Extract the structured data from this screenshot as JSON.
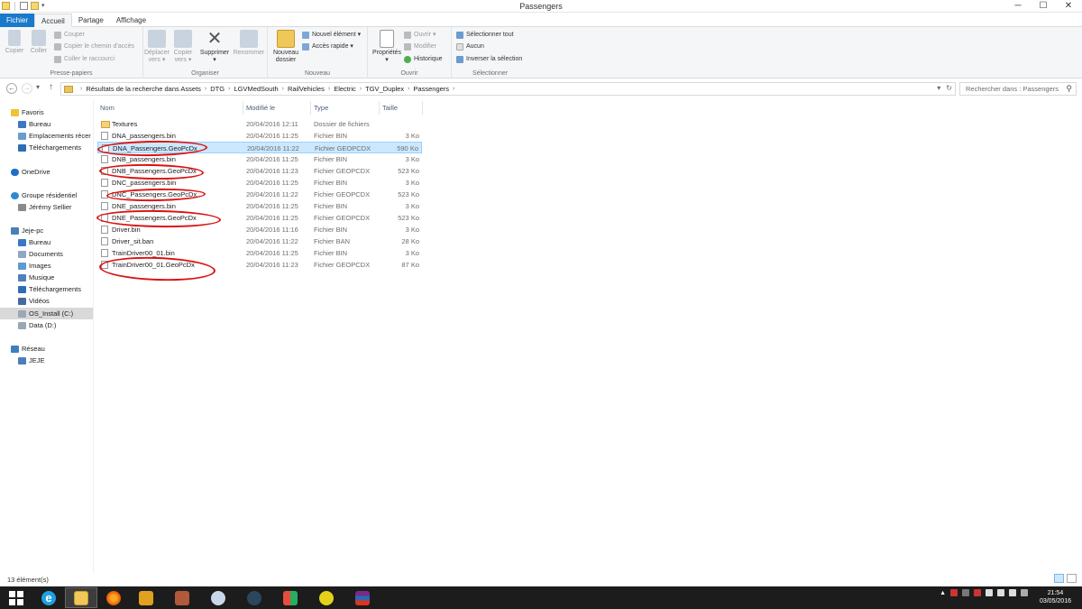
{
  "window": {
    "title": "Passengers",
    "controls": [
      "─",
      "☐",
      "✕"
    ]
  },
  "ribbon_tabs": [
    "Fichier",
    "Accueil",
    "Partage",
    "Affichage"
  ],
  "ribbon": {
    "presse_papiers": {
      "label": "Presse-papiers",
      "copier": "Copier",
      "coller": "Coller",
      "couper": "Couper",
      "copier_chemin": "Copier le chemin d'accès",
      "coller_raccourci": "Coller le raccourci"
    },
    "organiser": {
      "label": "Organiser",
      "deplacer_line1": "Déplacer",
      "deplacer_line2": "vers ▾",
      "copier_line1": "Copier",
      "copier_line2": "vers ▾",
      "supprimer_line1": "Supprimer",
      "supprimer_line2": "▾",
      "renommer": "Renommer"
    },
    "nouveau": {
      "label": "Nouveau",
      "dossier_line1": "Nouveau",
      "dossier_line2": "dossier",
      "nouvel_element": "Nouvel élément ▾",
      "acces_rapide": "Accès rapide ▾"
    },
    "ouvrir": {
      "label": "Ouvrir",
      "proprietes": "Propriétés",
      "proprietes_arrow": "▾",
      "ouvrir": "Ouvrir ▾",
      "modifier": "Modifier",
      "historique": "Historique"
    },
    "selectionner": {
      "label": "Sélectionner",
      "tout": "Sélectionner tout",
      "aucun": "Aucun",
      "inverser": "Inverser la sélection"
    }
  },
  "navigation": {
    "back": "←",
    "forward": "→",
    "recent": "▾",
    "up": "↑",
    "breadcrumb": [
      "Résultats de la recherche dans Assets",
      "DTG",
      "LGVMedSouth",
      "RailVehicles",
      "Electric",
      "TGV_Duplex",
      "Passengers"
    ],
    "address_dropdown": "▾",
    "refresh": "↻",
    "search_placeholder": "Rechercher dans : Passengers",
    "search_icon": "⚲"
  },
  "sidebar": [
    {
      "label": "Favoris",
      "icon": "star-icon",
      "color": "#f1c232"
    },
    {
      "label": "Bureau",
      "icon": "desktop-icon",
      "color": "#3b78c4"
    },
    {
      "label": "Emplacements récer",
      "icon": "recent-places-icon",
      "color": "#6a9bd1"
    },
    {
      "label": "Téléchargements",
      "icon": "downloads-icon",
      "color": "#2f6db5"
    },
    {
      "label": "OneDrive",
      "icon": "onedrive-icon",
      "color": "#1f6fc5"
    },
    {
      "label": "Groupe résidentiel",
      "icon": "homegroup-icon",
      "color": "#2c8ad1"
    },
    {
      "label": "Jérémy Sellier",
      "icon": "user-icon",
      "color": "#8a8a8a"
    },
    {
      "label": "Jeje-pc",
      "icon": "computer-icon",
      "color": "#4a7fb8"
    },
    {
      "label": "Bureau",
      "icon": "desktop-icon",
      "color": "#3b78c4"
    },
    {
      "label": "Documents",
      "icon": "documents-icon",
      "color": "#8fa8c4"
    },
    {
      "label": "Images",
      "icon": "images-icon",
      "color": "#5b9bd5"
    },
    {
      "label": "Musique",
      "icon": "music-icon",
      "color": "#4f81bd"
    },
    {
      "label": "Téléchargements",
      "icon": "downloads-icon",
      "color": "#2f6db5"
    },
    {
      "label": "Vidéos",
      "icon": "videos-icon",
      "color": "#466a9c"
    },
    {
      "label": "OS_Install (C:)",
      "icon": "drive-icon",
      "color": "#9aa7b5"
    },
    {
      "label": "Data (D:)",
      "icon": "drive-icon",
      "color": "#9aa7b5"
    },
    {
      "label": "Réseau",
      "icon": "network-icon",
      "color": "#3f7fc0"
    },
    {
      "label": "JEJE",
      "icon": "computer-icon",
      "color": "#4a7fb8"
    }
  ],
  "columns": [
    "Nom",
    "Modifié le",
    "Type",
    "Taille"
  ],
  "files": [
    {
      "name": "Textures",
      "date": "20/04/2016 12:11",
      "type": "Dossier de fichiers",
      "size": "",
      "icon": "folder-icon"
    },
    {
      "name": "DNA_passengers.bin",
      "date": "20/04/2016 11:25",
      "type": "Fichier BIN",
      "size": "3 Ko",
      "icon": "file-icon"
    },
    {
      "name": "DNA_Passengers.GeoPcDx",
      "date": "20/04/2016 11:22",
      "type": "Fichier GEOPCDX",
      "size": "590 Ko",
      "icon": "file-icon"
    },
    {
      "name": "DNB_passengers.bin",
      "date": "20/04/2016 11:25",
      "type": "Fichier BIN",
      "size": "3 Ko",
      "icon": "file-icon"
    },
    {
      "name": "DNB_Passengers.GeoPcDx",
      "date": "20/04/2016 11:23",
      "type": "Fichier GEOPCDX",
      "size": "523 Ko",
      "icon": "file-icon"
    },
    {
      "name": "DNC_passengers.bin",
      "date": "20/04/2016 11:25",
      "type": "Fichier BIN",
      "size": "3 Ko",
      "icon": "file-icon"
    },
    {
      "name": "DNC_Passengers.GeoPcDx",
      "date": "20/04/2016 11:22",
      "type": "Fichier GEOPCDX",
      "size": "523 Ko",
      "icon": "file-icon"
    },
    {
      "name": "DNE_passengers.bin",
      "date": "20/04/2016 11:25",
      "type": "Fichier BIN",
      "size": "3 Ko",
      "icon": "file-icon"
    },
    {
      "name": "DNE_Passengers.GeoPcDx",
      "date": "20/04/2016 11:25",
      "type": "Fichier GEOPCDX",
      "size": "523 Ko",
      "icon": "file-icon"
    },
    {
      "name": "Driver.bin",
      "date": "20/04/2016 11:16",
      "type": "Fichier BIN",
      "size": "3 Ko",
      "icon": "file-icon"
    },
    {
      "name": "Driver_sit.ban",
      "date": "20/04/2016 11:22",
      "type": "Fichier BAN",
      "size": "28 Ko",
      "icon": "file-icon"
    },
    {
      "name": "TrainDriver00_01.bin",
      "date": "20/04/2016 11:25",
      "type": "Fichier BIN",
      "size": "3 Ko",
      "icon": "file-icon"
    },
    {
      "name": "TrainDriver00_01.GeoPcDx",
      "date": "20/04/2016 11:23",
      "type": "Fichier GEOPCDX",
      "size": "87 Ko",
      "icon": "file-icon"
    }
  ],
  "selected_file": "DNA_Passengers.GeoPcDx",
  "annotations": {
    "color": "#d11111",
    "circled_files": [
      "DNA_Passengers.GeoPcDx",
      "DNB_Passengers.GeoPcDx",
      "DNC_Passengers.GeoPcDx",
      "DNE_Passengers.GeoPcDx",
      "TrainDriver00_01.GeoPcDx"
    ]
  },
  "status": {
    "count": "13 élément(s)"
  },
  "taskbar": {
    "apps": [
      "windows-start-icon",
      "internet-explorer-icon",
      "file-explorer-icon",
      "firefox-icon",
      "railworks-icon",
      "app-icon",
      "paint-icon",
      "steam-icon",
      "office-icon",
      "game-icon",
      "winrar-icon"
    ],
    "time": "21:54",
    "date": "03/05/2016"
  }
}
